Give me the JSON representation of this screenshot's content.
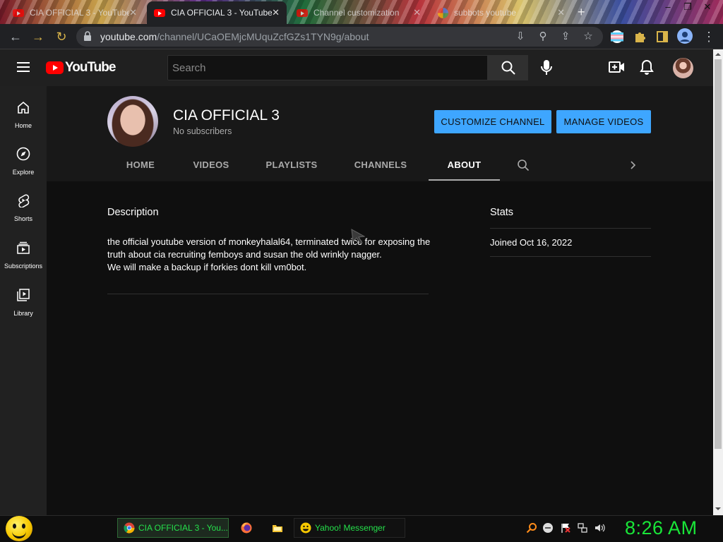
{
  "browser": {
    "tabs": [
      {
        "title": "CIA OFFICIAL 3 - YouTube",
        "favicon": "youtube-icon",
        "state": "inactive"
      },
      {
        "title": "CIA OFFICIAL 3 - YouTube",
        "favicon": "youtube-icon",
        "state": "active"
      },
      {
        "title": "Channel customization",
        "favicon": "youtube-icon",
        "state": "inactive"
      },
      {
        "title": "subbots youtube",
        "favicon": "google-icon",
        "state": "inactive"
      }
    ],
    "new_tab": "+",
    "url_domain": "youtube.com",
    "url_path": "/channel/UCaOEMjcMUquZcfGZs1TYN9g/about"
  },
  "youtube": {
    "logo_text": "YouTube",
    "search_placeholder": "Search",
    "guide": [
      {
        "label": "Home",
        "icon": "home-icon"
      },
      {
        "label": "Explore",
        "icon": "compass-icon"
      },
      {
        "label": "Shorts",
        "icon": "shorts-icon"
      },
      {
        "label": "Subscriptions",
        "icon": "subscriptions-icon"
      },
      {
        "label": "Library",
        "icon": "library-icon"
      }
    ],
    "channel": {
      "name": "CIA OFFICIAL 3",
      "subscribers": "No subscribers",
      "customize_label": "CUSTOMIZE CHANNEL",
      "manage_label": "MANAGE VIDEOS",
      "accent_color": "#3ea6ff",
      "tabs": [
        "HOME",
        "VIDEOS",
        "PLAYLISTS",
        "CHANNELS",
        "ABOUT"
      ],
      "active_tab": "ABOUT"
    },
    "about": {
      "description_heading": "Description",
      "description_lines": [
        "the official youtube version of monkeyhalal64, terminated twice for exposing the",
        "truth about cia recruiting femboys and susan the old wrinkly nagger.",
        "We will make a backup if forkies dont kill vm0bot."
      ],
      "stats_heading": "Stats",
      "joined": "Joined Oct 16, 2022"
    }
  },
  "taskbar": {
    "tasks": [
      {
        "label": "CIA OFFICIAL 3 - You...",
        "icon": "chrome-icon",
        "state": "active"
      },
      {
        "label": "Yahoo! Messenger",
        "icon": "yahoo-messenger-icon",
        "state": "inactive"
      }
    ],
    "clock": "8:26 AM",
    "clock_color": "#19e638"
  }
}
